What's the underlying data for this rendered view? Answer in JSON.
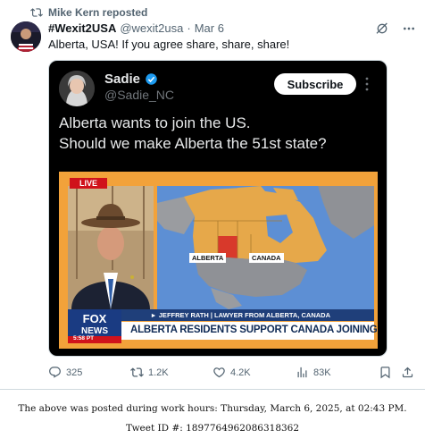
{
  "repost": {
    "text": "Mike Kern reposted"
  },
  "post": {
    "display_name": "#Wexit2USA",
    "handle": "@wexit2usa",
    "separator": "·",
    "date": "Mar 6",
    "text": "Alberta, USA! If you agree share, share, share!"
  },
  "embedded": {
    "display_name": "Sadie",
    "handle": "@Sadie_NC",
    "subscribe_label": "Subscribe",
    "text_line1": "Alberta wants to join the US.",
    "text_line2": "Should we make Alberta the 51st state?",
    "tv": {
      "live_tag": "LIVE",
      "network_line1": "FOX",
      "network_line2": "NEWS",
      "clock": "5:58 PT",
      "map_label_alberta": "ALBERTA",
      "map_label_canada": "CANADA",
      "chyron_sub": "JEFFREY RATH | LAWYER FROM ALBERTA, CANADA",
      "chyron_main": "ALBERTA RESIDENTS SUPPORT CANADA JOINING THE U.S."
    }
  },
  "actions": {
    "replies": "325",
    "reposts": "1.2K",
    "likes": "4.2K",
    "views": "83K"
  },
  "caption": {
    "line1": "The above was posted during work hours: Thursday, March 6, 2025, at 02:43 PM.",
    "line2": "Tweet ID #: 1897764962086318362"
  },
  "colors": {
    "secondary_text": "#536471",
    "verified_badge": "#1d9bf0",
    "fox_blue": "#1f3f7a",
    "map_ocean": "#5d8fd4",
    "map_canada": "#e6a84a",
    "chyron_orange": "#f08a1c"
  },
  "icons": [
    "repost-icon",
    "grok-icon",
    "more-icon",
    "verified-badge-icon",
    "reply-icon",
    "like-icon",
    "views-icon",
    "bookmark-icon",
    "share-icon"
  ]
}
